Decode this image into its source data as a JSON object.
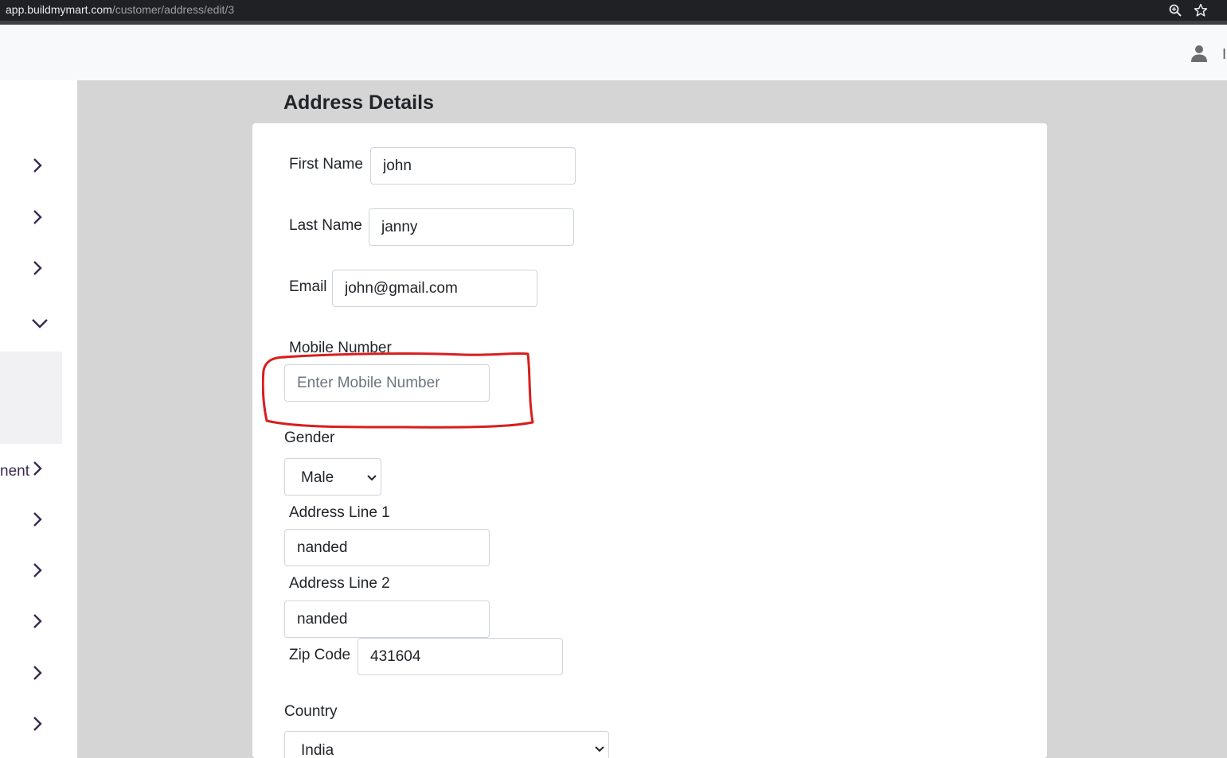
{
  "browser": {
    "url_domain": "app.buildmymart.com",
    "url_path": "/customer/address/edit/3"
  },
  "header": {
    "truncated_text": "I"
  },
  "sidebar": {
    "partial_label": "nent"
  },
  "page": {
    "title": "Address Details"
  },
  "form": {
    "first_name": {
      "label": "First Name",
      "value": "john"
    },
    "last_name": {
      "label": "Last Name",
      "value": "janny"
    },
    "email": {
      "label": "Email",
      "value": "john@gmail.com"
    },
    "mobile": {
      "label": "Mobile Number",
      "placeholder": "Enter Mobile Number",
      "value": ""
    },
    "gender": {
      "label": "Gender",
      "selected": "Male"
    },
    "address1": {
      "label": "Address Line 1",
      "value": "nanded"
    },
    "address2": {
      "label": "Address Line 2",
      "value": "nanded"
    },
    "zip": {
      "label": "Zip Code",
      "value": "431604"
    },
    "country": {
      "label": "Country",
      "selected": "India"
    }
  },
  "colors": {
    "annotation": "#d81e1e",
    "content_bg": "#d5d5d5",
    "sidebar_icon": "#3a2a4e"
  }
}
